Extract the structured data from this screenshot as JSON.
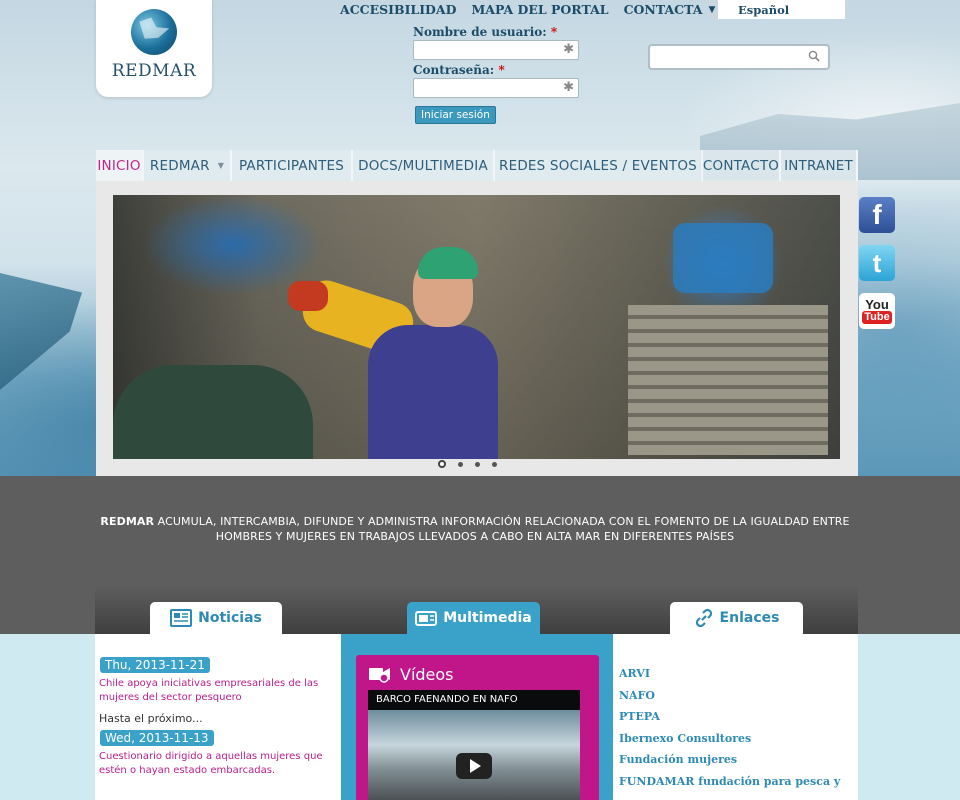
{
  "logo": {
    "text": "REDMAR"
  },
  "topnav": {
    "items": [
      "ACCESIBILIDAD",
      "MAPA DEL PORTAL",
      "CONTACTA"
    ]
  },
  "language": {
    "selected": "Español"
  },
  "login": {
    "username_label": "Nombre de usuario:",
    "password_label": "Contraseña:",
    "required_mark": "*",
    "submit_label": "Iniciar sesión"
  },
  "search": {
    "placeholder": ""
  },
  "mainnav": {
    "items": [
      "INICIO",
      "REDMAR",
      "PARTICIPANTES",
      "DOCS/MULTIMEDIA",
      "REDES SOCIALES / EVENTOS",
      "CONTACTO",
      "INTRANET"
    ]
  },
  "slider": {
    "slide_count": 4,
    "active_index": 0
  },
  "social": [
    "facebook-icon",
    "twitter-icon",
    "youtube-icon"
  ],
  "band": {
    "brand": "REDMAR",
    "text": " ACUMULA, INTERCAMBIA, DIFUNDE Y ADMINISTRA INFORMACIÓN RELACIONADA CON EL FOMENTO DE LA IGUALDAD ENTRE HOMBRES Y MUJERES EN TRABAJOS LLEVADOS A CABO EN ALTA MAR EN DIFERENTES PAÍSES"
  },
  "sections": {
    "noticias": "Noticias",
    "multimedia": "Multimedia",
    "enlaces": "Enlaces"
  },
  "news": [
    {
      "date": "Thu, 2013-11-21",
      "title": "Chile apoya iniciativas empresariales de las mujeres del sector pesquero",
      "more": "Hasta el próximo..."
    },
    {
      "date": "Wed, 2013-11-13",
      "title": "Cuestionario dirigido a aquellas mujeres que estén o hayan estado embarcadas.",
      "more": ""
    }
  ],
  "videos": {
    "heading": "Vídeos",
    "title": "BARCO FAENANDO EN NAFO"
  },
  "links": [
    "ARVI",
    "NAFO",
    "PTEPA",
    "Ibernexo Consultores",
    "Fundación mujeres",
    "FUNDAMAR fundación para pesca y"
  ],
  "colors": {
    "accent": "#3aa2c9",
    "magenta": "#c1168a",
    "navy": "#1d4c68"
  }
}
